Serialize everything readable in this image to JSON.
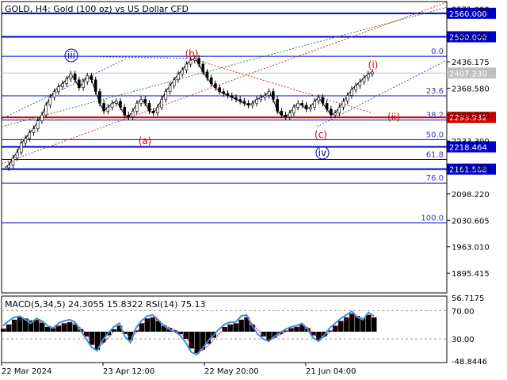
{
  "header": {
    "title": "GOLD, H4:  Gold (100 oz) vs US Dollar CFD"
  },
  "colors": {
    "background": "#ffffff",
    "frame": "#000000",
    "level_blue": "#0000cc",
    "level_red": "#cc0000",
    "wave_red": "#dd0000",
    "wave_blue": "#0000cc",
    "fib_text": "#3a3aa8",
    "price_line": "#000000",
    "macd_hist": "#000000",
    "macd_signal": "#d00000",
    "rsi": "#3d8fe0",
    "grid": "#9a9a9a"
  },
  "chart_data": {
    "type": "candlestick",
    "symbol": "GOLD",
    "timeframe": "H4",
    "ylim": [
      1845,
      2590
    ],
    "price_axis_ticks": [
      "2571.000",
      "2503.565",
      "2436.175",
      "2368.580",
      "2300.970",
      "2233.390",
      "2165.800",
      "2098.220",
      "2030.605",
      "1963.010",
      "1895.415"
    ],
    "price_axis_tick_values": [
      2571.0,
      2503.565,
      2436.175,
      2368.58,
      2300.97,
      2233.39,
      2165.8,
      2098.22,
      2030.605,
      1963.01,
      1895.415
    ],
    "current_price": {
      "value": 2407.23,
      "label": "2407.230"
    },
    "horizontal_levels": [
      {
        "value": 2560.0,
        "label": "2560.000",
        "color": "blue",
        "thick": true
      },
      {
        "value": 2500.0,
        "label": "2500.000",
        "color": "blue",
        "thick": true
      },
      {
        "value": 2293.932,
        "label": "2293.932",
        "color": "red",
        "thick": true
      },
      {
        "value": 2218.464,
        "label": "2218.464",
        "color": "blue",
        "thick": true
      },
      {
        "value": 2161.568,
        "label": "2161.568",
        "color": "blue",
        "thick": true
      }
    ],
    "fibonacci_levels": [
      {
        "label": "0.0",
        "value": 2450.0
      },
      {
        "label": "23.6",
        "value": 2349.0
      },
      {
        "label": "38.2",
        "value": 2287.0
      },
      {
        "label": "50.0",
        "value": 2237.0
      },
      {
        "label": "61.8",
        "value": 2186.0
      },
      {
        "label": "76.0",
        "value": 2126.0
      },
      {
        "label": "100.0",
        "value": 2024.0
      }
    ],
    "time_labels": [
      "22 Mar 2024",
      "23 Apr 12:00",
      "22 May 20:00",
      "21 Jun 04:00"
    ],
    "wave_labels": [
      {
        "label": "iii",
        "circled": true,
        "color": "blue"
      },
      {
        "label": "(a)",
        "circled": false,
        "color": "red"
      },
      {
        "label": "(b)",
        "circled": false,
        "color": "red"
      },
      {
        "label": "(c)",
        "circled": false,
        "color": "red"
      },
      {
        "label": "iv",
        "circled": true,
        "color": "blue"
      },
      {
        "label": "(i)",
        "circled": false,
        "color": "red"
      },
      {
        "label": "(ii)",
        "circled": false,
        "color": "red"
      }
    ],
    "close_series": [
      2165,
      2172,
      2190,
      2205,
      2228,
      2240,
      2255,
      2265,
      2285,
      2300,
      2325,
      2345,
      2360,
      2372,
      2380,
      2392,
      2405,
      2390,
      2370,
      2385,
      2400,
      2390,
      2360,
      2330,
      2310,
      2320,
      2330,
      2335,
      2320,
      2300,
      2295,
      2310,
      2330,
      2340,
      2330,
      2310,
      2305,
      2320,
      2340,
      2360,
      2375,
      2390,
      2405,
      2415,
      2430,
      2440,
      2445,
      2430,
      2410,
      2395,
      2380,
      2370,
      2360,
      2355,
      2350,
      2345,
      2340,
      2335,
      2330,
      2325,
      2330,
      2340,
      2345,
      2350,
      2360,
      2340,
      2310,
      2300,
      2295,
      2305,
      2320,
      2330,
      2325,
      2315,
      2320,
      2335,
      2345,
      2330,
      2315,
      2300,
      2305,
      2320,
      2335,
      2350,
      2365,
      2375,
      2385,
      2395,
      2405,
      2410
    ],
    "indicator": {
      "label": "MACD(5,34,5) 24.3055 15.8322 RSI(14) 75.13",
      "ylim": [
        -48.8446,
        56.7175
      ],
      "ticks": [
        {
          "label": "56.7175",
          "value": 56.7175
        },
        {
          "label": "70.00",
          "value": 35.0
        },
        {
          "label": "30.00",
          "value": -12.0
        },
        {
          "label": "-48.8446",
          "value": -48.8446
        }
      ],
      "macd_hist": [
        5,
        12,
        20,
        24,
        22,
        18,
        20,
        15,
        8,
        6,
        10,
        14,
        16,
        12,
        4,
        -8,
        -22,
        -30,
        -18,
        -6,
        4,
        10,
        -4,
        -14,
        2,
        14,
        22,
        24,
        18,
        10,
        6,
        2,
        -4,
        -12,
        -28,
        -36,
        -30,
        -20,
        -10,
        0,
        8,
        12,
        14,
        20,
        24,
        12,
        0,
        -8,
        -14,
        -10,
        -4,
        2,
        6,
        8,
        12,
        6,
        -6,
        -14,
        -8,
        2,
        10,
        18,
        24,
        30,
        26,
        22,
        28,
        24
      ],
      "macd_signal": [
        2,
        8,
        15,
        20,
        21,
        19,
        19,
        16,
        10,
        7,
        9,
        12,
        15,
        13,
        6,
        -4,
        -16,
        -26,
        -20,
        -10,
        0,
        6,
        -1,
        -10,
        -2,
        10,
        18,
        22,
        19,
        12,
        7,
        3,
        -2,
        -9,
        -22,
        -32,
        -31,
        -24,
        -14,
        -4,
        4,
        9,
        12,
        17,
        21,
        14,
        3,
        -5,
        -11,
        -10,
        -5,
        0,
        4,
        7,
        10,
        7,
        -3,
        -11,
        -9,
        -1,
        7,
        14,
        20,
        26,
        25,
        22,
        25,
        23
      ],
      "rsi": [
        10,
        18,
        24,
        26,
        20,
        14,
        22,
        18,
        10,
        6,
        14,
        18,
        20,
        16,
        2,
        -12,
        -26,
        -32,
        -14,
        -2,
        8,
        14,
        -8,
        -18,
        6,
        18,
        26,
        28,
        20,
        10,
        4,
        0,
        -6,
        -18,
        -34,
        -38,
        -28,
        -16,
        -6,
        4,
        12,
        16,
        16,
        26,
        28,
        10,
        -4,
        -12,
        -16,
        -8,
        -2,
        4,
        8,
        10,
        14,
        4,
        -10,
        -16,
        -6,
        6,
        14,
        22,
        28,
        34,
        24,
        20,
        32,
        26
      ]
    }
  }
}
